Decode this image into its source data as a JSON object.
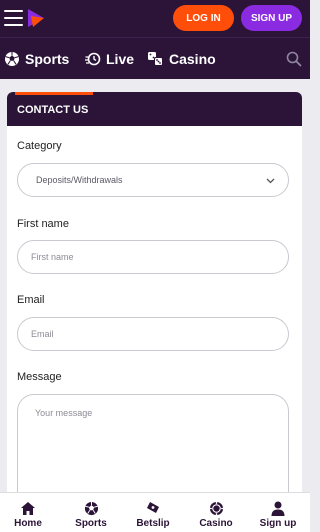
{
  "header": {
    "login_label": "LOG IN",
    "signup_label": "SIGN UP",
    "colors": {
      "background": "#2b1438",
      "login": "#ff4d0a",
      "signup": "#8a2be2"
    }
  },
  "nav": {
    "items": [
      {
        "label": "Sports",
        "icon": "soccer-ball-icon"
      },
      {
        "label": "Live",
        "icon": "live-clock-icon"
      },
      {
        "label": "Casino",
        "icon": "dice-icon"
      }
    ],
    "search_icon": "search-icon"
  },
  "contact": {
    "title": "CONTACT US",
    "category_label": "Category",
    "category_value": "Deposits/Withdrawals",
    "first_name_label": "First name",
    "first_name_placeholder": "First name",
    "email_label": "Email",
    "email_placeholder": "Email",
    "message_label": "Message",
    "message_placeholder": "Your message"
  },
  "bottom_nav": {
    "items": [
      {
        "label": "Home",
        "icon": "home-icon"
      },
      {
        "label": "Sports",
        "icon": "soccer-ball-icon"
      },
      {
        "label": "Betslip",
        "icon": "ticket-icon"
      },
      {
        "label": "Casino",
        "icon": "casino-chip-icon"
      },
      {
        "label": "Sign up",
        "icon": "user-icon"
      }
    ]
  }
}
